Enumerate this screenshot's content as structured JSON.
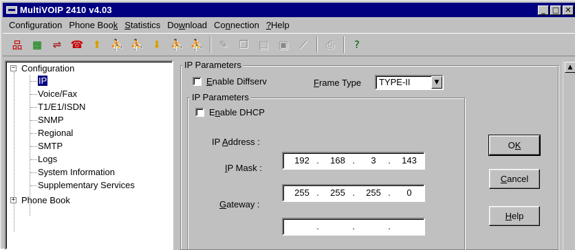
{
  "window": {
    "title": "MultiVOIP 2410 v4.03",
    "controls": {
      "minimize": "_",
      "maximize": "□",
      "close": "✕"
    }
  },
  "menu": [
    {
      "pre": "Confi",
      "u": "g",
      "post": "uration"
    },
    {
      "pre": "Phone Boo",
      "u": "k",
      "post": ""
    },
    {
      "pre": "",
      "u": "S",
      "post": "tatistics"
    },
    {
      "pre": "Do",
      "u": "w",
      "post": "nload"
    },
    {
      "pre": "Co",
      "u": "n",
      "post": "nection"
    },
    {
      "pre": "",
      "u": "?",
      "post": "Help"
    }
  ],
  "toolbar": {
    "icons": [
      {
        "name": "network-icon",
        "glyph": "品",
        "color": "#c00000",
        "enabled": true
      },
      {
        "name": "board-icon",
        "glyph": "▦",
        "color": "#008000",
        "enabled": true
      },
      {
        "name": "link-icon",
        "glyph": "⇌",
        "color": "#a00000",
        "enabled": true
      },
      {
        "name": "phone-icon",
        "glyph": "☎",
        "color": "#cc0000",
        "enabled": true
      },
      {
        "name": "upload-icon",
        "glyph": "⬆",
        "color": "#d4a000",
        "enabled": true
      },
      {
        "name": "person-icon",
        "glyph": "⛹",
        "color": "#8a8a8a",
        "enabled": false
      },
      {
        "name": "person-alt-icon",
        "glyph": "⛹",
        "color": "#8a8a8a",
        "enabled": false
      },
      {
        "name": "download-icon",
        "glyph": "⬇",
        "color": "#d4a000",
        "enabled": true
      },
      {
        "name": "person2-icon",
        "glyph": "⛹",
        "color": "#8a8a8a",
        "enabled": false
      },
      {
        "name": "person3-icon",
        "glyph": "⛹",
        "color": "#8a8a8a",
        "enabled": false
      },
      {
        "sep": true
      },
      {
        "name": "pen-icon",
        "glyph": "✎",
        "color": "#8a8a8a",
        "enabled": false
      },
      {
        "name": "copy-icon",
        "glyph": "❐",
        "color": "#8a8a8a",
        "enabled": false
      },
      {
        "name": "document-icon",
        "glyph": "▤",
        "color": "#8a8a8a",
        "enabled": false
      },
      {
        "name": "monitor-icon",
        "glyph": "▣",
        "color": "#8a8a8a",
        "enabled": false
      },
      {
        "name": "graph-icon",
        "glyph": "⟋",
        "color": "#8a8a8a",
        "enabled": false
      },
      {
        "sep": true
      },
      {
        "name": "print-icon",
        "glyph": "⎙",
        "color": "#8a8a8a",
        "enabled": false
      },
      {
        "sep": true
      },
      {
        "name": "help-icon",
        "glyph": "?",
        "color": "#006000",
        "enabled": true
      }
    ]
  },
  "tree": {
    "root": "Configuration",
    "root_expander": "−",
    "children": [
      "IP",
      "Voice/Fax",
      "T1/E1/ISDN",
      "SNMP",
      "Regional",
      "SMTP",
      "Logs",
      "System Information",
      "Supplementary Services"
    ],
    "phonebook": "Phone Book",
    "phonebook_expander": "+"
  },
  "panel": {
    "outer_group_title": "IP Parameters",
    "enable_diffserv": {
      "pre": "",
      "u": "E",
      "post": "nable Diffserv",
      "checked": false
    },
    "frame_type": {
      "pre": "",
      "u": "F",
      "post": "rame Type",
      "value": "TYPE-II"
    },
    "inner_group_title": "IP Parameters",
    "enable_dhcp": {
      "pre": "E",
      "u": "n",
      "post": "able DHCP",
      "checked": false
    },
    "ip_address": {
      "pre": "IP ",
      "u": "A",
      "post": "ddress :",
      "octets": [
        "192",
        "168",
        "3",
        "143"
      ]
    },
    "ip_mask": {
      "pre": "",
      "u": "I",
      "post": "P Mask :",
      "octets": [
        "255",
        "255",
        "255",
        "0"
      ]
    },
    "gateway": {
      "pre": "",
      "u": "G",
      "post": "ateway :",
      "octets": [
        "",
        "",
        "",
        ""
      ]
    }
  },
  "buttons": {
    "ok": {
      "pre": "O",
      "u": "K",
      "post": ""
    },
    "cancel": {
      "pre": "",
      "u": "C",
      "post": "ancel"
    },
    "help": {
      "pre": "",
      "u": "H",
      "post": "elp"
    }
  },
  "scroll_up_glyph": "▲",
  "dropdown_glyph": "▼"
}
